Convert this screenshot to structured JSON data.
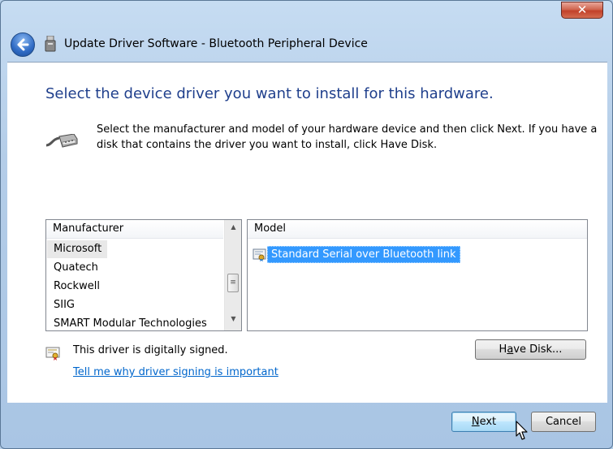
{
  "window": {
    "title": "Update Driver Software - Bluetooth Peripheral Device",
    "close_label": "✕"
  },
  "content": {
    "heading": "Select the device driver you want to install for this hardware.",
    "instructions": "Select the manufacturer and model of your hardware device and then click Next. If you have a disk that contains the driver you want to install, click Have Disk."
  },
  "manufacturer_list": {
    "header": "Manufacturer",
    "items": [
      "Microsoft",
      "Quatech",
      "Rockwell",
      "SIIG",
      "SMART Modular Technologies"
    ],
    "selected": "Microsoft"
  },
  "model_list": {
    "header": "Model",
    "items": [
      "Standard Serial over Bluetooth link"
    ],
    "selected": "Standard Serial over Bluetooth link"
  },
  "signing": {
    "status": "This driver is digitally signed.",
    "link": "Tell me why driver signing is important"
  },
  "buttons": {
    "have_disk_pre": "H",
    "have_disk_u": "a",
    "have_disk_post": "ve Disk...",
    "next_u": "N",
    "next_post": "ext",
    "cancel": "Cancel"
  },
  "icons": {
    "back": "back-arrow-icon",
    "title": "usb-device-icon",
    "device": "serial-cable-icon",
    "model": "driver-certificate-icon",
    "signed": "signed-certificate-icon"
  },
  "colors": {
    "heading": "#1f3f8c",
    "link": "#0066cc",
    "selection": "#3399ff",
    "close_button": "#c2412a"
  }
}
